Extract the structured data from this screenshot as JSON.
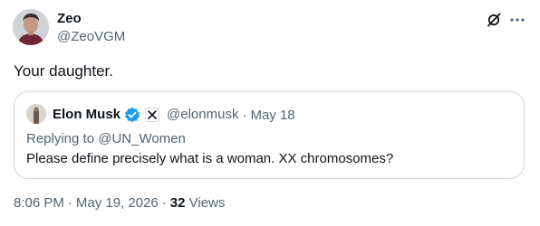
{
  "author": {
    "name": "Zeo",
    "handle": "@ZeoVGM"
  },
  "tweet": {
    "text": "Your daughter."
  },
  "quoted": {
    "name": "Elon Musk",
    "handle": "@elonmusk",
    "separator": "·",
    "date": "May 18",
    "reply_prefix": "Replying to ",
    "reply_to": "@UN_Women",
    "text": "Please define precisely what is a woman. XX chromosomes?"
  },
  "meta": {
    "time": "8:06 PM",
    "separator": "·",
    "date": "May 19, 2026",
    "views_count": "32",
    "views_label": "Views"
  },
  "icons": {
    "grok": "grok-icon",
    "more": "more-icon",
    "verified": "verified-badge-icon",
    "affiliation": "x-affiliation-icon"
  },
  "colors": {
    "text": "#0f1419",
    "secondary": "#536471",
    "border": "#cfd9de",
    "verified": "#1d9bf0"
  }
}
